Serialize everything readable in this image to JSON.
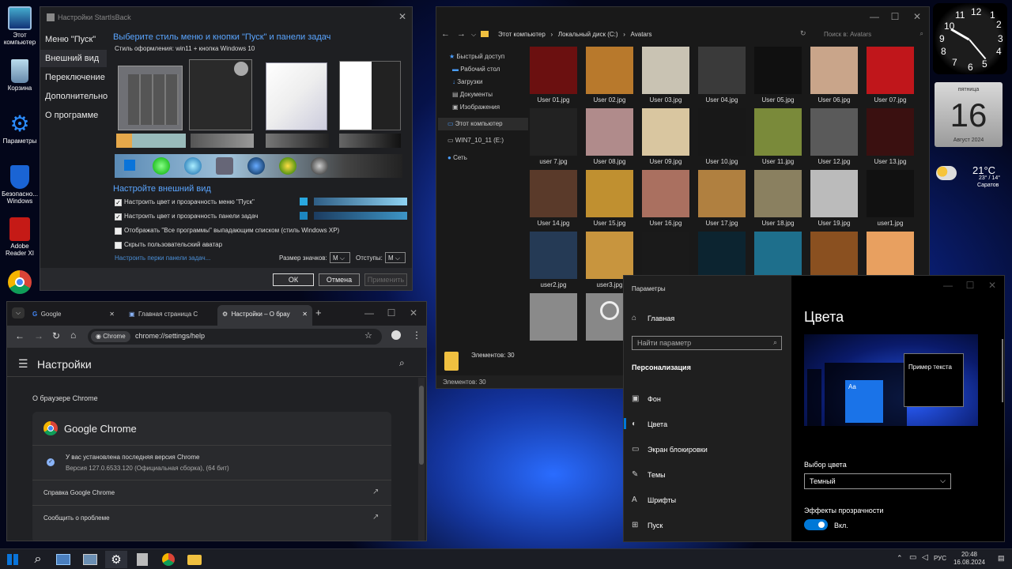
{
  "desktop": {
    "icons": [
      "Этот компьютер",
      "Корзина",
      "Параметры",
      "Безопасно... Windows",
      "Adobe Reader XI",
      "Google Chrome"
    ]
  },
  "startback": {
    "title": "Настройки StartIsBack",
    "nav": [
      "Меню \"Пуск\"",
      "Внешний вид",
      "Переключение",
      "Дополнительно",
      "О программе"
    ],
    "heading": "Выберите стиль меню и кнопки \"Пуск\" и панели задач",
    "style_label": "Стиль оформления:",
    "style_value": "win11 + кнопка Windows 10",
    "section2": "Настройте внешний вид",
    "opt1": "Настроить цвет и прозрачность меню \"Пуск\"",
    "opt2": "Настроить цвет и прозрачность панели задач",
    "opt3": "Отображать \"Все программы\" выпадающим списком (стиль Windows XP)",
    "opt4": "Скрыть пользовательский аватар",
    "link": "Настроить перки панели задач...",
    "icon_size_label": "Размер значков:",
    "icon_size_value": "M",
    "padding_label": "Отступы:",
    "padding_value": "M",
    "ok": "ОК",
    "cancel": "Отмена",
    "apply": "Применить"
  },
  "explorer": {
    "path": [
      "Этот компьютер",
      "Локальный диск (C:)",
      "Avatars"
    ],
    "search_placeholder": "Поиск в: Avatars",
    "tree": [
      "Быстрый доступ",
      "Рабочий стол",
      "Загрузки",
      "Документы",
      "Изображения",
      "Этот компьютер",
      "WIN7_10_11 (E:)",
      "Сеть"
    ],
    "files": [
      "User 01.jpg",
      "User 02.jpg",
      "User 03.jpg",
      "User 04.jpg",
      "User 05.jpg",
      "User 06.jpg",
      "User 07.jpg",
      "user 7.jpg",
      "User 08.jpg",
      "User 09.jpg",
      "User 10.jpg",
      "User 11.jpg",
      "User 12.jpg",
      "User 13.jpg",
      "User 14.jpg",
      "User 15.jpg",
      "User 16.jpg",
      "User 17.jpg",
      "User 18.jpg",
      "User 19.jpg",
      "user1.jpg",
      "user2.jpg",
      "user3.jpg",
      "",
      "",
      "",
      "",
      "",
      "",
      ""
    ],
    "count_label": "Элементов: 30",
    "status": "Элементов: 30"
  },
  "chrome": {
    "tabs": [
      "Google",
      "Главная страница C",
      "Настройки – О брау"
    ],
    "chip": "Chrome",
    "url": "chrome://settings/help",
    "title": "Настройки",
    "section": "О браузере Chrome",
    "product": "Google Chrome",
    "status": "У вас установлена последняя версия Chrome",
    "version": "Версия 127.0.6533.120 (Официальная сборка), (64 бит)",
    "help": "Справка Google Chrome",
    "report": "Сообщить о проблеме"
  },
  "settings": {
    "title": "Параметры",
    "home": "Главная",
    "search_placeholder": "Найти параметр",
    "category": "Персонализация",
    "items": [
      "Фон",
      "Цвета",
      "Экран блокировки",
      "Темы",
      "Шрифты",
      "Пуск"
    ],
    "heading": "Цвета",
    "sample_text": "Пример текста",
    "preview_tile": "Aa",
    "color_label": "Выбор цвета",
    "color_value": "Темный",
    "transparency_label": "Эффекты прозрачности",
    "transparency_value": "Вкл."
  },
  "gadgets": {
    "clock_numbers": [
      "12",
      "1",
      "11",
      "10",
      "2",
      "9",
      "3",
      "8",
      "4",
      "7",
      "5",
      "6"
    ],
    "day_of_week": "пятница",
    "day": "16",
    "month_year": "Август 2024",
    "temp": "21°C",
    "range": "23° / 14°",
    "city": "Саратов"
  },
  "taskbar": {
    "lang": "РУС",
    "time": "20:48",
    "date": "16.08.2024"
  },
  "colors": {
    "accent": "#0078d7",
    "chrome_blue": "#8ab4f8"
  }
}
